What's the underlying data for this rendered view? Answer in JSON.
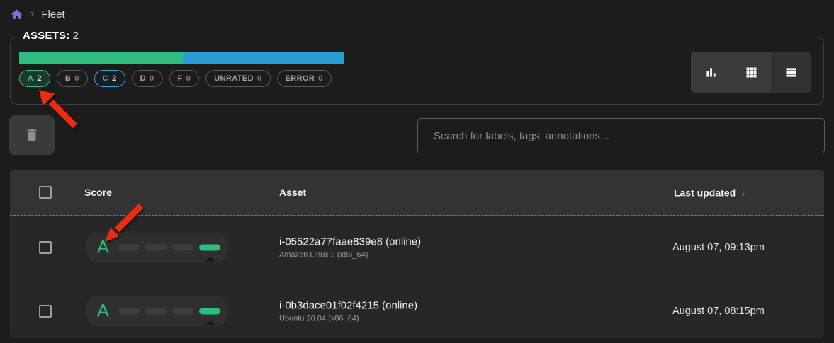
{
  "colors": {
    "accent_green": "#2ebd7f",
    "accent_blue": "#2d9bd5",
    "arrow_red": "#ed2b10",
    "home_purple": "#7f6bdf"
  },
  "breadcrumb": {
    "separator": "›",
    "current": "Fleet"
  },
  "assets_panel": {
    "legend_label": "ASSETS:",
    "legend_count": "2",
    "distribution": {
      "segments": [
        {
          "grade": "A",
          "color": "#2ebd7f",
          "percent": 50.4
        },
        {
          "grade": "C",
          "color": "#2d9bd5",
          "percent": 49.6
        }
      ]
    },
    "pills": [
      {
        "label": "A",
        "count": "2"
      },
      {
        "label": "B",
        "count": "0"
      },
      {
        "label": "C",
        "count": "2"
      },
      {
        "label": "D",
        "count": "0"
      },
      {
        "label": "F",
        "count": "0"
      },
      {
        "label": "UNRATED",
        "count": "0"
      },
      {
        "label": "ERROR",
        "count": "0"
      }
    ]
  },
  "toolbar": {
    "search_placeholder": "Search for labels, tags, annotations..."
  },
  "table": {
    "headers": {
      "score": "Score",
      "asset": "Asset",
      "last_updated": "Last updated"
    },
    "sort_glyph": "↓",
    "rows": [
      {
        "score": "A",
        "asset_name": "i-05522a77faae839e8 (online)",
        "platform": "Amazon Linux 2 (x86_64)",
        "last_updated": "August 07, 09:13pm"
      },
      {
        "score": "A",
        "asset_name": "i-0b3dace01f02f4215 (online)",
        "platform": "Ubuntu 20.04 (x86_64)",
        "last_updated": "August 07, 08:15pm"
      }
    ]
  }
}
